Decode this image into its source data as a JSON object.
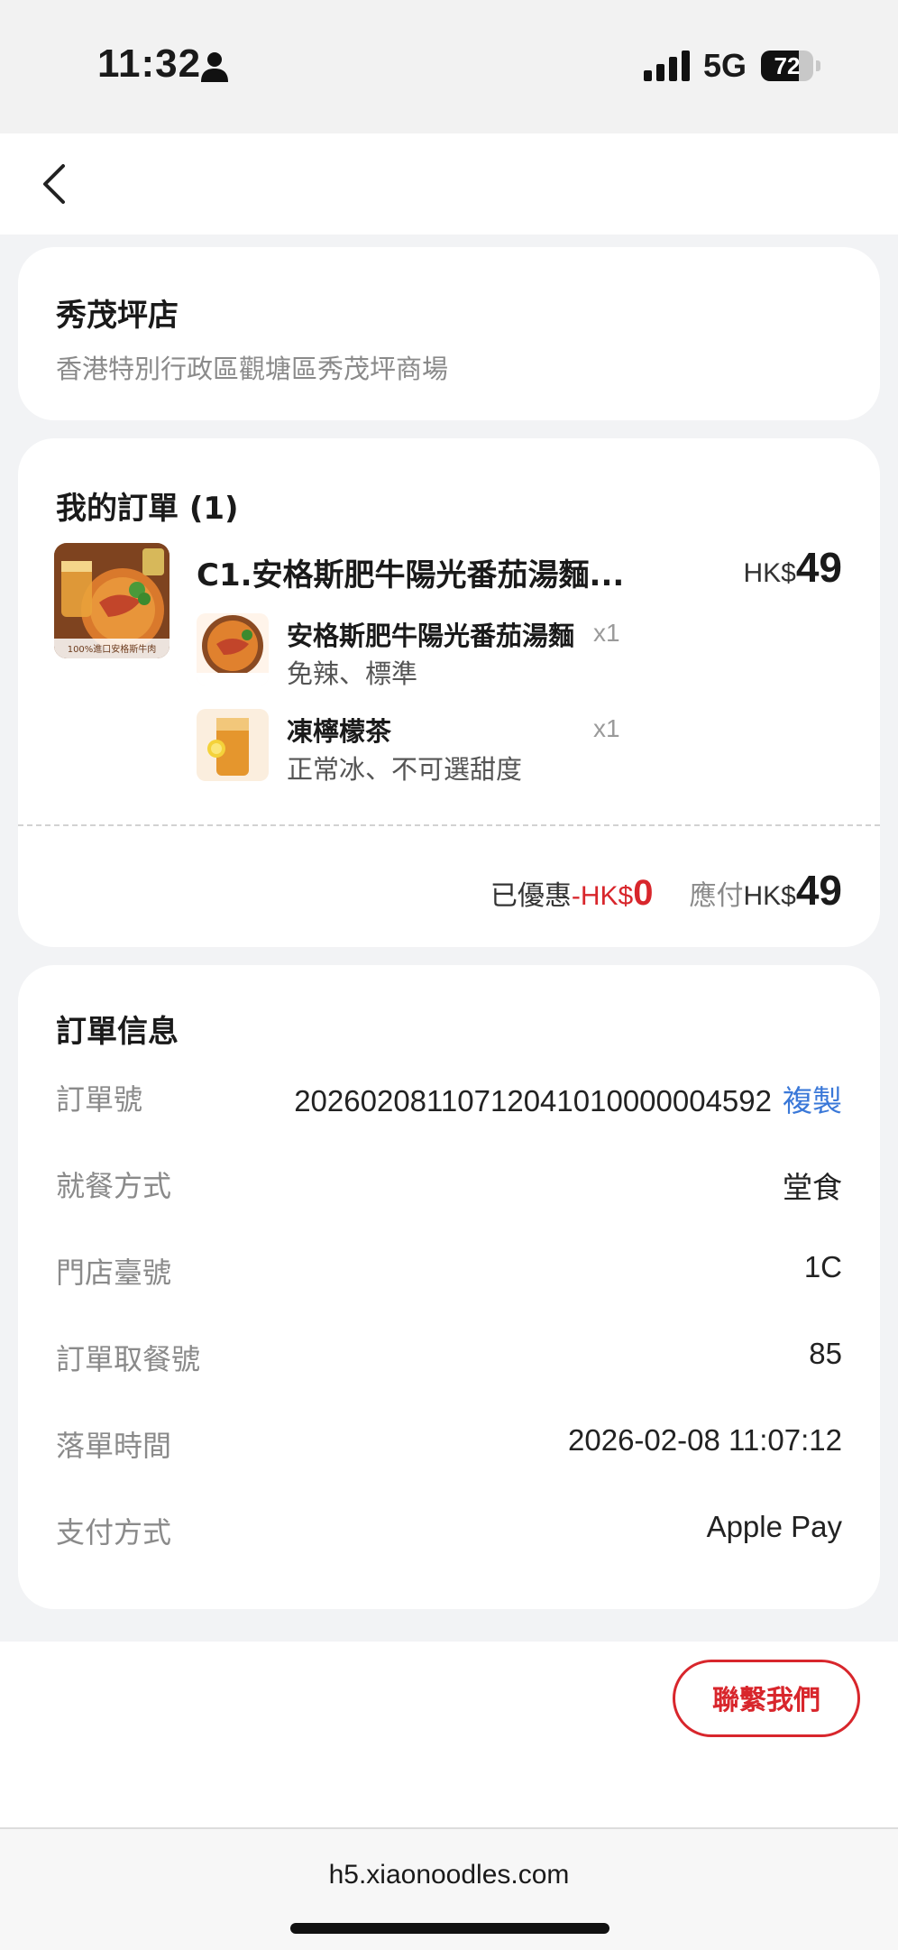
{
  "status_bar": {
    "time": "11:32",
    "network": "5G",
    "battery_percent": "72",
    "battery_level": 0.72,
    "icons": [
      "person-icon",
      "signal-icon",
      "battery-icon"
    ]
  },
  "nav": {
    "back_icon": "chevron-left-icon"
  },
  "store": {
    "name": "秀茂坪店",
    "address": "香港特別行政區觀塘區秀茂坪商場"
  },
  "order": {
    "title": "我的訂單 (1)",
    "combo": {
      "name": "C1.安格斯肥牛陽光番茄湯麵...",
      "currency": "HK$",
      "price": "49",
      "thumb_caption": "100%進口安格斯牛肉"
    },
    "items": [
      {
        "name": "安格斯肥牛陽光番茄湯麵",
        "qty": "x1",
        "options": "免辣、標準"
      },
      {
        "name": "凍檸檬茶",
        "qty": "x1",
        "options": "正常冰、不可選甜度"
      }
    ],
    "discount_label": "已優惠",
    "discount_prefix": "-HK$",
    "discount_value": "0",
    "payable_label": "應付",
    "payable_currency": "HK$",
    "payable_value": "49"
  },
  "order_info": {
    "title": "訂單信息",
    "order_no_label": "訂單號",
    "order_no": "2026020811071204101000000459​2",
    "copy_label": "複製",
    "rows": [
      {
        "label": "就餐方式",
        "value": "堂食"
      },
      {
        "label": "門店臺號",
        "value": "1C"
      },
      {
        "label": "訂單取餐號",
        "value": "85"
      },
      {
        "label": "落單時間",
        "value": "2026-02-08 11:07:12"
      },
      {
        "label": "支付方式",
        "value": "Apple Pay"
      }
    ]
  },
  "actions": {
    "contact_label": "聯繫我們"
  },
  "browser": {
    "url": "h5.xiaonoodles.com"
  },
  "colors": {
    "accent_red": "#d8262c",
    "link_blue": "#3a78d8",
    "background": "#f2f3f5"
  }
}
